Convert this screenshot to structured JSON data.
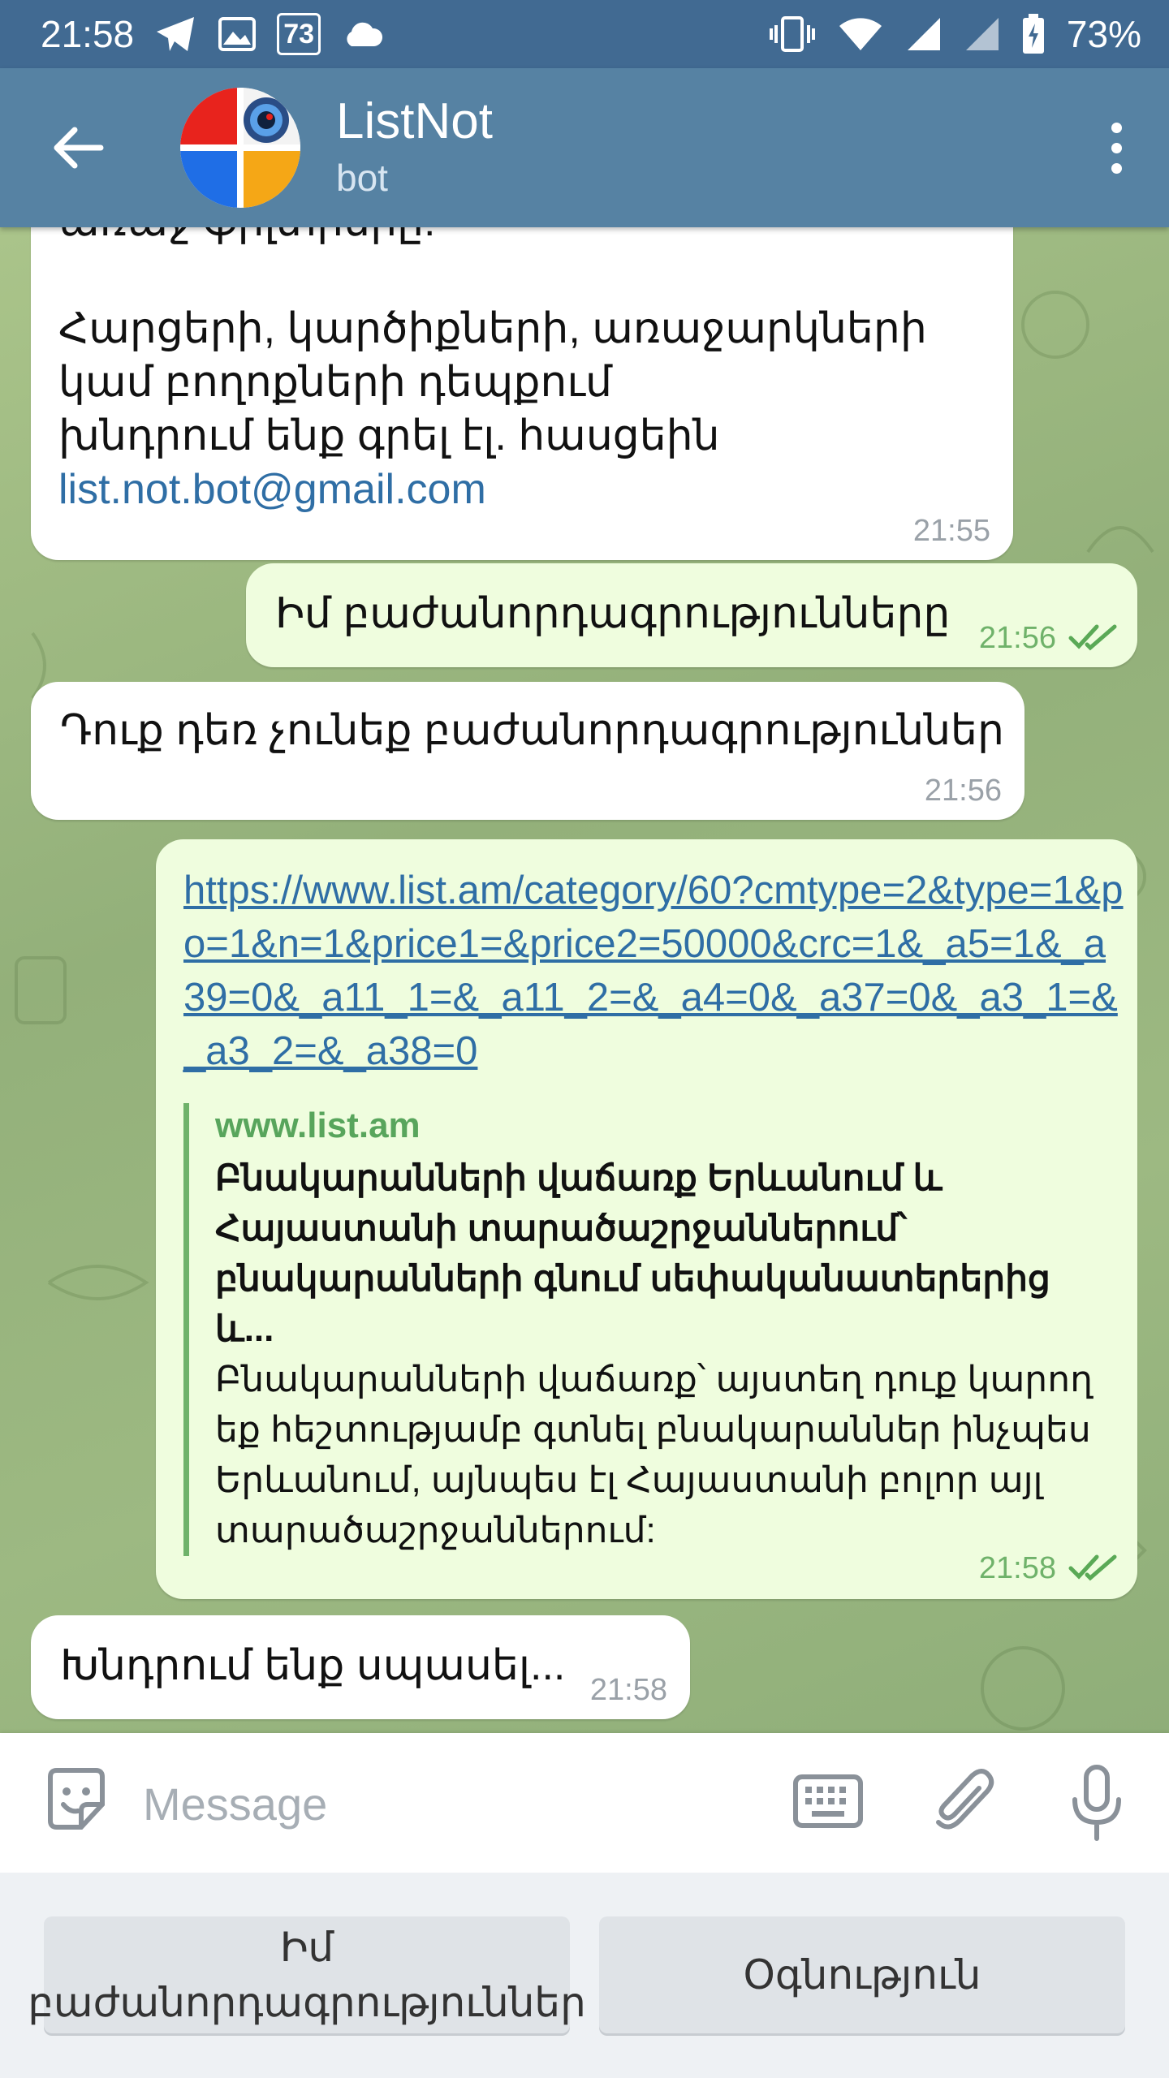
{
  "status_bar": {
    "time": "21:58",
    "badge": "73",
    "battery": "73%"
  },
  "header": {
    "title": "ListNot",
    "subtitle": "bot"
  },
  "messages": [
    {
      "type": "incoming",
      "lines": [
        "առաջ ֆիլտրերը:",
        "",
        "Հարցերի, կարծիքների, առաջարկների",
        "կամ բողոքների դեպքում",
        "խնդրում ենք գրել էլ. հասցեին"
      ],
      "email": "list.not.bot@gmail.com",
      "time": "21:55"
    },
    {
      "type": "outgoing",
      "text": "Իմ բաժանորդագրությունները",
      "time": "21:56"
    },
    {
      "type": "incoming",
      "text": "Դուք դեռ չունեք բաժանորդագրություններ",
      "time": "21:56"
    },
    {
      "type": "outgoing",
      "url": "https://www.list.am/category/60?cmtype=2&type=1&po=1&n=1&price1=&price2=50000&crc=1&_a5=1&_a39=0&_a11_1=&_a11_2=&_a4=0&_a37=0&_a3_1=&_a3_2=&_a38=0",
      "preview_site": "www.list.am",
      "preview_title": "Բնակարանների վաճառք Երևանում և Հայաստանի տարածաշրջաններում՝ բնակարանների գնում սեփականատերերից և...",
      "preview_desc": "Բնակարանների վաճառք՝ այստեղ դուք կարող եք հեշտությամբ գտնել բնակարաններ ինչպես Երևանում, այնպես էլ Հայաստանի բոլոր այլ տարածաշրջաններում:",
      "time": "21:58"
    },
    {
      "type": "incoming",
      "text": "Խնդրում ենք սպասել...",
      "time": "21:58"
    }
  ],
  "input": {
    "placeholder": "Message"
  },
  "keyboard": {
    "button1": "Իմ բաժանորդագրություններ",
    "button2": "Օգնություն"
  },
  "colors": {
    "status_bar": "#416a92",
    "header": "#5682a3",
    "outgoing_bubble": "#effdde",
    "link": "#2f6ea5",
    "accent_green": "#6fb26a"
  },
  "icons": {
    "back": "arrow-left-icon",
    "menu": "more-vertical-icon",
    "emoji": "sticker-icon",
    "keyboard": "keyboard-icon",
    "attach": "paperclip-icon",
    "mic": "microphone-icon"
  }
}
